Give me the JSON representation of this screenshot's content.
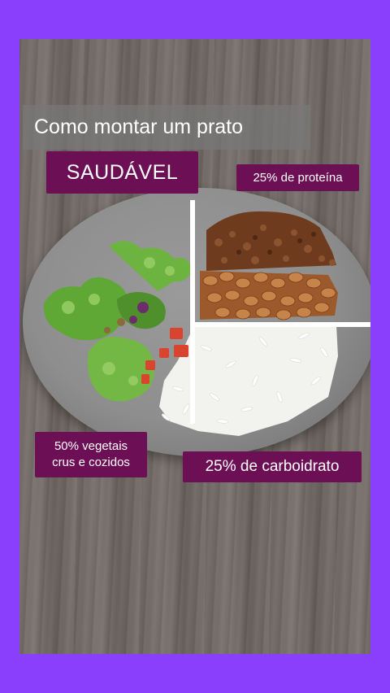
{
  "title": "Como montar um prato",
  "subtitle": "SAUDÁVEL",
  "labels": {
    "protein": "25% de proteína",
    "vegetables_line1": "50% vegetais",
    "vegetables_line2": "crus e cozidos",
    "carbs": "25% de carboidrato"
  },
  "colors": {
    "frame": "#8a3ffc",
    "label_bg": "#6d0f55",
    "title_bg": "#787878"
  }
}
